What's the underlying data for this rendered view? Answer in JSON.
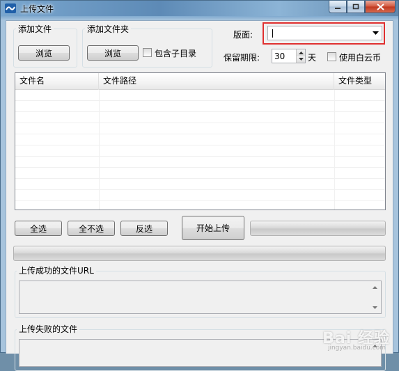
{
  "window": {
    "title": "上传文件"
  },
  "add_file": {
    "label": "添加文件",
    "browse": "浏览"
  },
  "add_folder": {
    "label": "添加文件夹",
    "browse": "浏览",
    "include_subdirs": "包含子目录"
  },
  "layout": {
    "label": "版面:",
    "value": ""
  },
  "retention": {
    "label": "保留期限:",
    "value": "30",
    "unit": "天"
  },
  "use_baiyun": {
    "label": "使用白云币"
  },
  "file_list": {
    "columns": [
      "文件名",
      "文件路径",
      "文件类型"
    ],
    "rows": []
  },
  "actions": {
    "select_all": "全选",
    "select_none": "全不选",
    "invert": "反选",
    "start_upload": "开始上传"
  },
  "success_group": {
    "label": "上传成功的文件URL"
  },
  "failed_group": {
    "label": "上传失败的文件"
  },
  "watermark": {
    "text": "Bai 经验",
    "sub": "jingyan.baidu.com"
  }
}
